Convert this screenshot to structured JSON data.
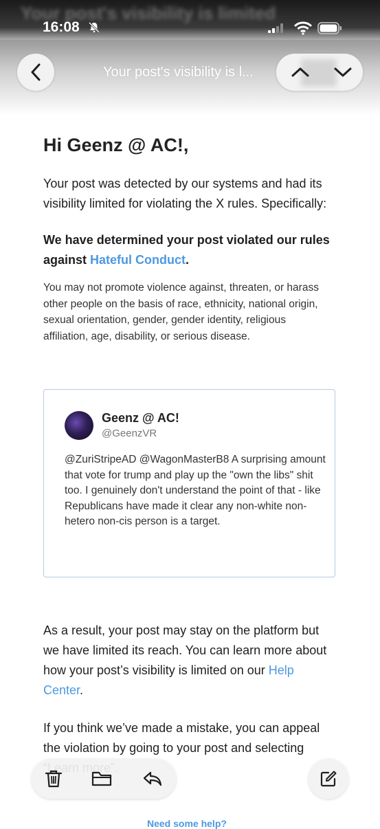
{
  "status": {
    "time": "16:08",
    "blurred_title": "Your post's visibility is limited"
  },
  "nav": {
    "title": "Your post's visibility is l..."
  },
  "email": {
    "greeting": "Hi Geenz @ AC!,",
    "intro": "Your post was detected by our systems and had its visibility limited for violating the X rules. Specifically:",
    "determination_prefix": "We have determined your post violated our rules against ",
    "rule_link": "Hateful Conduct",
    "determination_suffix": ".",
    "rule_description": "You may not promote violence against, threaten, or harass other people on the basis of race, ethnicity, national origin, sexual orientation, gender, gender identity, religious affiliation, age, disability, or serious disease.",
    "tweet": {
      "name": "Geenz @ AC!",
      "handle": "@GeenzVR",
      "text": "@ZuriStripeAD @WagonMasterB8 A surprising amount that vote for trump and play up the \"own the libs\" shit too. I genuinely don't understand the point of that - like Republicans have made it clear any non-white non-hetero non-cis person is a target."
    },
    "result_prefix": "As a result, your post may stay on the platform but we have limited its reach. You can learn more about how your post’s visibility is limited on our ",
    "help_center_link": "Help Center",
    "result_suffix": ".",
    "appeal": "If you think we’ve made a mistake, you can appeal the violation by going to your post and selecting “Learn more”.",
    "need_help": "Need some help?"
  },
  "colors": {
    "link": "#4b99e2",
    "card_border": "#b7c9db"
  },
  "icons": [
    "bell-slash-icon",
    "signal-icon",
    "wifi-icon",
    "battery-icon",
    "chevron-left-icon",
    "chevron-up-icon",
    "chevron-down-icon",
    "trash-icon",
    "folder-icon",
    "reply-icon",
    "compose-icon"
  ]
}
